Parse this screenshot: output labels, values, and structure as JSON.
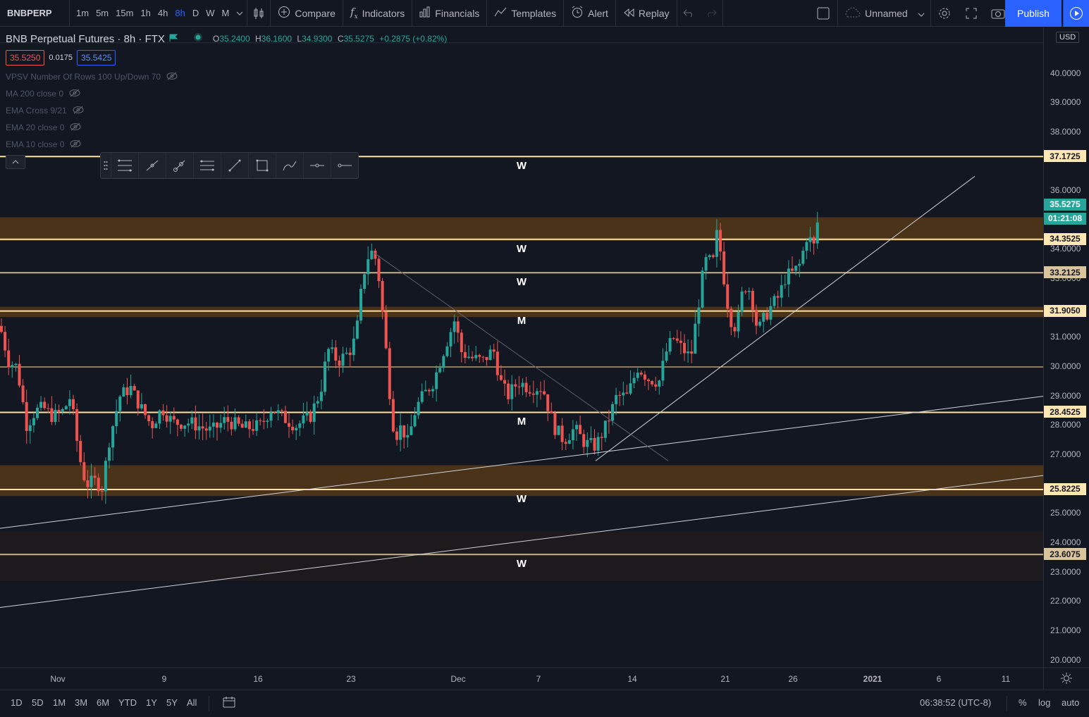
{
  "toolbar": {
    "symbol": "BNBPERP",
    "intervals": [
      "1m",
      "5m",
      "15m",
      "1h",
      "4h",
      "8h",
      "D",
      "W",
      "M"
    ],
    "active_interval": "8h",
    "compare": "Compare",
    "indicators": "Indicators",
    "financials": "Financials",
    "templates": "Templates",
    "alert": "Alert",
    "replay": "Replay",
    "layout_name": "Unnamed",
    "publish": "Publish"
  },
  "legend": {
    "title": "BNB Perpetual Futures · 8h · FTX",
    "o_label": "O",
    "o": "35.2400",
    "h_label": "H",
    "h": "36.1600",
    "l_label": "L",
    "l": "34.9300",
    "c_label": "C",
    "c": "35.5275",
    "change": "+0.2875 (+0.82%)",
    "bid": "35.5250",
    "spread": "0.0175",
    "ask": "35.5425",
    "indicators": [
      "VPSV Number Of Rows 100 Up/Down 70",
      "MA 200 close 0",
      "EMA Cross 9/21",
      "EMA 20 close 0",
      "EMA 10 close 0"
    ]
  },
  "price_scale": {
    "currency": "USD",
    "labels": [
      "40.0000",
      "39.0000",
      "38.0000",
      "36.0000",
      "34.0000",
      "33.0000",
      "31.0000",
      "30.0000",
      "29.0000",
      "28.0000",
      "27.0000",
      "25.0000",
      "24.0000",
      "23.0000",
      "22.0000",
      "21.0000",
      "20.0000"
    ],
    "last_price": "35.5275",
    "countdown": "01:21:08",
    "levels": [
      {
        "price": "37.1725",
        "text": "W",
        "color": "#ffe0a0"
      },
      {
        "price": "34.3525",
        "text": "W",
        "color": "#ffe0a0"
      },
      {
        "price": "33.2125",
        "text": "W",
        "color": "#c8b48c"
      },
      {
        "price": "31.9050",
        "text": "M",
        "color": "#ffe0a0"
      },
      {
        "price": "28.4525",
        "text": "M",
        "color": "#ffe0a0"
      },
      {
        "price": "25.8225",
        "text": "W",
        "color": "#ffe0a0"
      },
      {
        "price": "23.6075",
        "text": "W",
        "color": "#c8b48c"
      }
    ]
  },
  "time_axis": [
    "Nov",
    "9",
    "16",
    "23",
    "Dec",
    "7",
    "14",
    "21",
    "26",
    "2021",
    "6",
    "11"
  ],
  "bottom": {
    "ranges": [
      "1D",
      "5D",
      "1M",
      "3M",
      "6M",
      "YTD",
      "1Y",
      "5Y",
      "All"
    ],
    "clock": "06:38:52 (UTC-8)",
    "percent": "%",
    "log": "log",
    "auto": "auto"
  },
  "colors": {
    "up": "#26a69a",
    "down": "#ef5350",
    "zone": "#4a3319",
    "accent": "#2962ff"
  }
}
